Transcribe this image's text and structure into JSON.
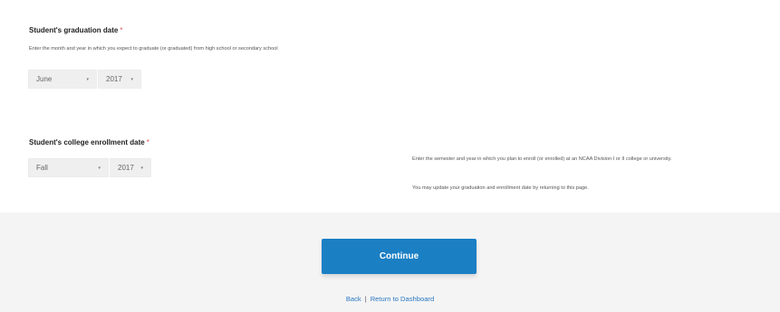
{
  "graduation": {
    "label": "Student's graduation date",
    "required_mark": "*",
    "help": "Enter the month and year in which you expect to graduate (or graduated) from high school or secondary school",
    "month_value": "June",
    "year_value": "2017"
  },
  "enrollment": {
    "label": "Student's college enrollment date",
    "required_mark": "*",
    "semester_value": "Fall",
    "year_value": "2017",
    "help1": "Enter the semester and year in which you plan to enroll (or enrolled) at an NCAA Division I or II college or university.",
    "help2": "You may update your graduation and enrollment date by returning to this page."
  },
  "footer": {
    "continue_label": "Continue",
    "back_label": "Back",
    "separator": "|",
    "dashboard_label": "Return to Dashboard"
  },
  "icons": {
    "caret": "▾"
  },
  "colors": {
    "primary": "#1b7fc4",
    "required": "#d9534f",
    "link": "#2a79c0",
    "footer_bg": "#f4f4f5"
  }
}
